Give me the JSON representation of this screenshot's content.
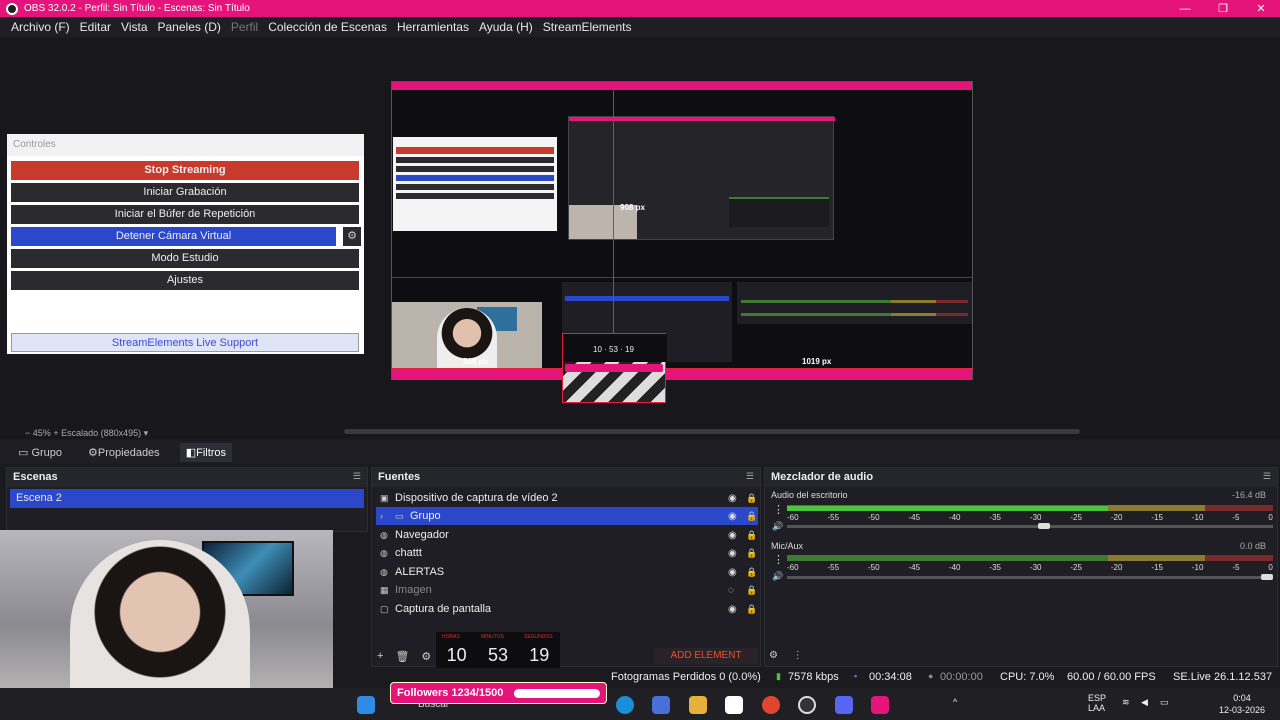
{
  "window": {
    "title": "OBS 32.0.2 - Perfil: Sin Título - Escenas: Sin Título",
    "minimize": "—",
    "maximize": "❐",
    "close": "✕"
  },
  "menu": [
    "Archivo (F)",
    "Editar",
    "Vista",
    "Paneles (D)",
    "Perfil",
    "Colección de Escenas",
    "Herramientas",
    "Ayuda (H)",
    "StreamElements"
  ],
  "controls": {
    "header": "Controles",
    "stop_streaming": "Stop Streaming",
    "start_recording": "Iniciar Grabación",
    "replay_buffer": "Iniciar el Búfer de Repetición",
    "virtual_camera": "Detener Cámara Virtual",
    "studio_mode": "Modo Estudio",
    "settings": "Ajustes",
    "support": "StreamElements Live Support"
  },
  "preview": {
    "zoom": "45%",
    "scale": "Escalado (880x495)",
    "label_908": "908 px",
    "label_569": "569 px",
    "label_1019": "1019 px"
  },
  "source_tabs": {
    "group": "Grupo",
    "properties": "Propiedades",
    "filters": "Filtros"
  },
  "scenes": {
    "title": "Escenas",
    "items": [
      "Escena 2"
    ]
  },
  "sources": {
    "title": "Fuentes",
    "items": [
      {
        "label": "Dispositivo de captura de vídeo 2",
        "icon": "camera-icon"
      },
      {
        "label": "Grupo",
        "icon": "folder-icon"
      },
      {
        "label": "Navegador",
        "icon": "globe-icon"
      },
      {
        "label": "chattt",
        "icon": "globe-icon"
      },
      {
        "label": "ALERTAS",
        "icon": "globe-icon"
      },
      {
        "label": "Imagen",
        "icon": "image-icon"
      },
      {
        "label": "Captura de pantalla",
        "icon": "monitor-icon"
      }
    ],
    "add_element": "ADD ELEMENT"
  },
  "mixer": {
    "title": "Mezclador de audio",
    "channels": [
      {
        "name": "Audio del escritorio",
        "db": "-16.4 dB",
        "level": 0.66,
        "volume": 0.53
      },
      {
        "name": "Mic/Aux",
        "db": "0.0 dB",
        "level": 0.0,
        "volume": 1.0
      }
    ],
    "ticks": [
      "-60",
      "-55",
      "-50",
      "-45",
      "-40",
      "-35",
      "-30",
      "-25",
      "-20",
      "-15",
      "-10",
      "-5",
      "0"
    ]
  },
  "timer": {
    "hours": "10",
    "minutes": "53",
    "seconds": "19",
    "hours_label": "HORAS",
    "minutes_label": "MINUTOS",
    "seconds_label": "SEGUNDOS"
  },
  "status": {
    "dropped_frames": "Fotogramas Perdidos 0 (0.0%)",
    "bitrate": "7578 kbps",
    "stream_time": "00:34:08",
    "rec_time": "00:00:00",
    "cpu": "CPU: 7.0%",
    "fps": "60.00 / 60.00 FPS",
    "version": "SE.Live 26.1.12.537"
  },
  "overlay": {
    "followers": "Followers 1234/1500",
    "progress": 0.82
  },
  "taskbar": {
    "search": "Buscar",
    "lang": "ESP",
    "lang2": "LAA",
    "time": "0:04",
    "date": "12-03-2026"
  },
  "colors": {
    "accent": "#e5147b",
    "selection": "#2a48c9",
    "stop": "#c73a2c"
  }
}
